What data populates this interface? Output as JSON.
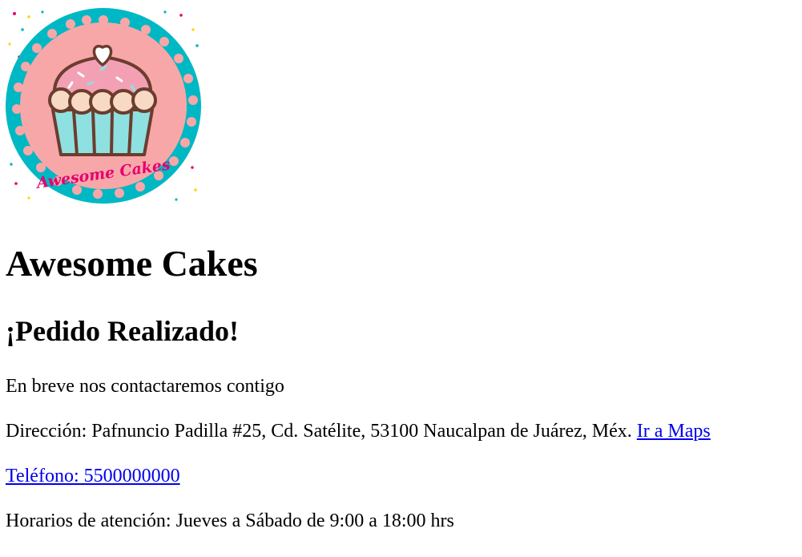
{
  "logo": {
    "name": "awesome-cakes-logo",
    "text": "Awesome Cakes",
    "colors": {
      "ring": "#00b8c4",
      "background": "#f8a7a8",
      "cream": "#f7d9c4",
      "cup": "#8ee1e0",
      "outline": "#6b3d2e",
      "text": "#e6006f"
    }
  },
  "content": {
    "title": "Awesome Cakes",
    "subtitle": "¡Pedido Realizado!",
    "message": "En breve nos contactaremos contigo",
    "address_label": "Dirección: Pafnuncio Padilla #25, Cd. Satélite, 53100 Naucalpan de Juárez, Méx.",
    "maps_link": "Ir a Maps",
    "phone_link": "Teléfono: 5500000000",
    "hours": "Horarios de atención: Jueves a Sábado de 9:00 a 18:00 hrs"
  }
}
